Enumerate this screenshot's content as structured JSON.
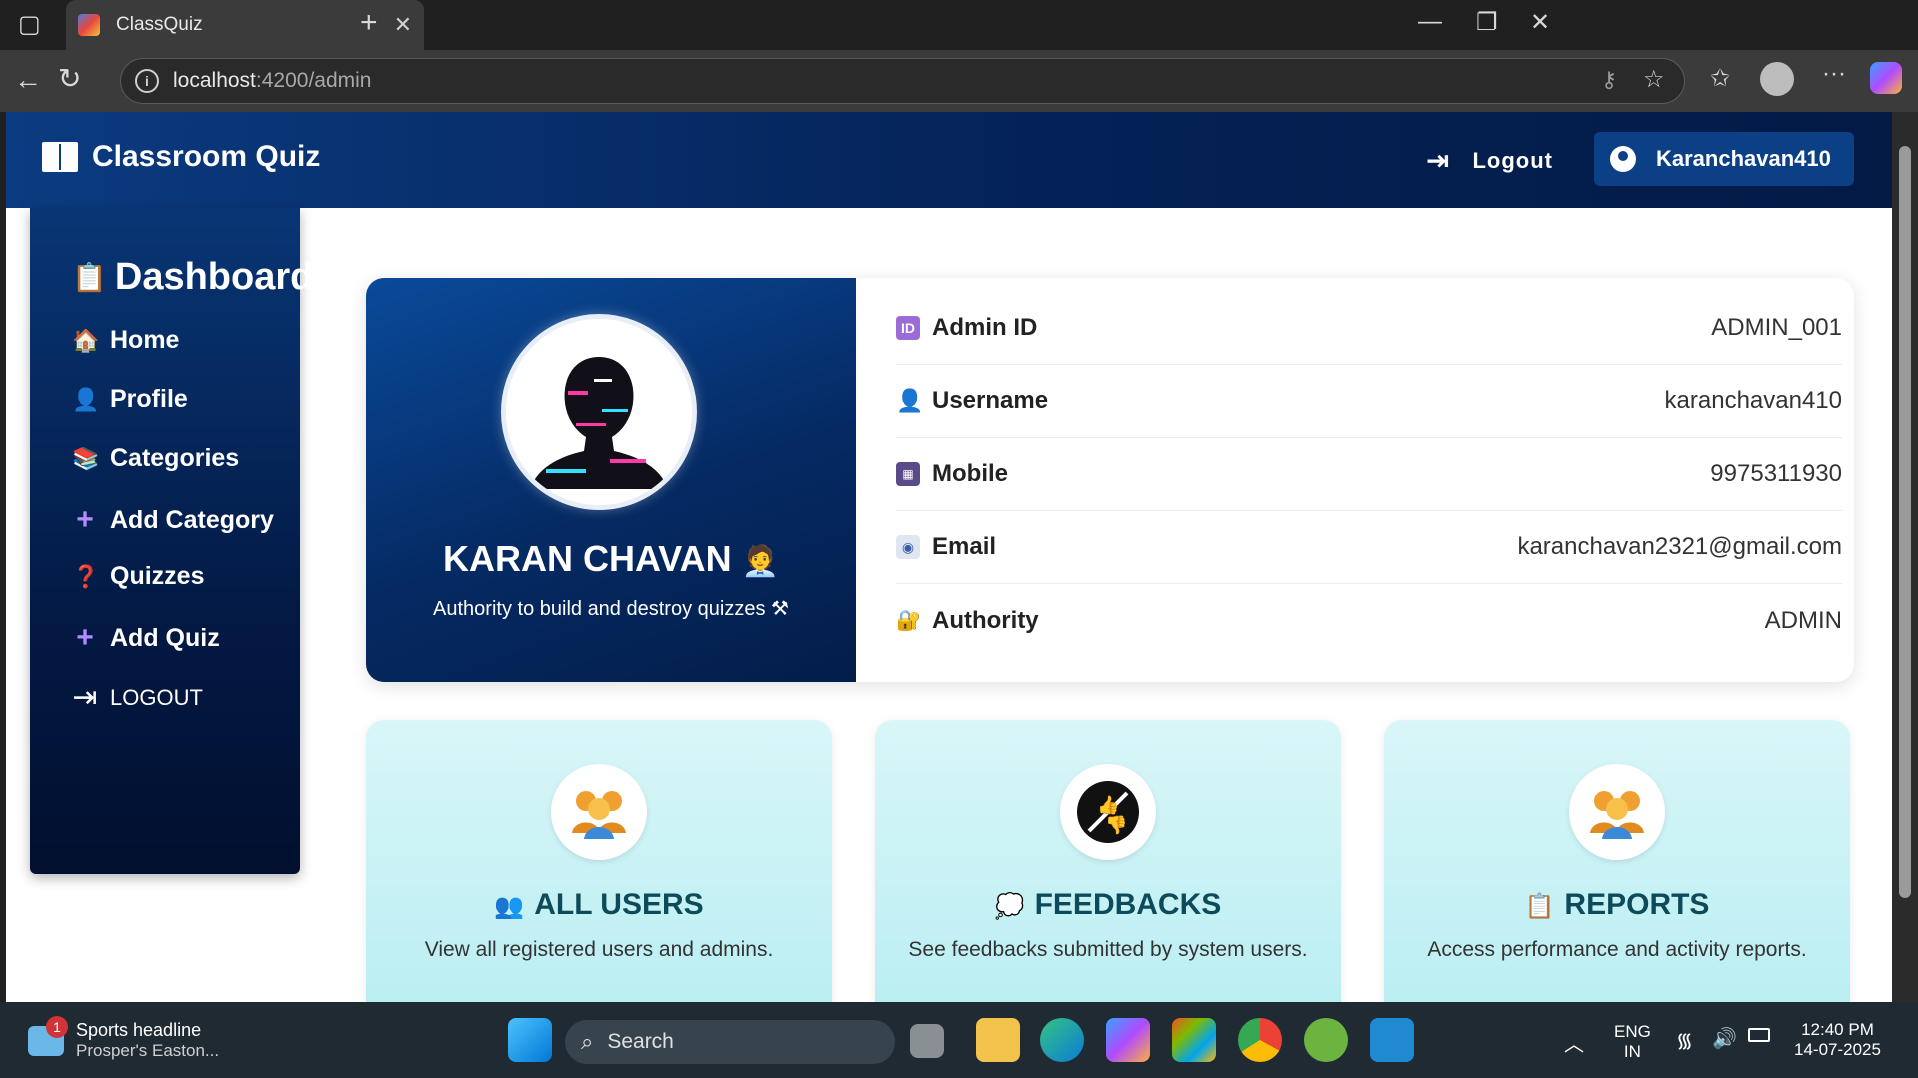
{
  "browser": {
    "tab_title": "ClassQuiz",
    "url_host": "localhost",
    "url_rest": ":4200/admin"
  },
  "navbar": {
    "brand": "Classroom Quiz",
    "logout": "Logout",
    "user": "Karanchavan410"
  },
  "sidebar": {
    "title": "Dashboard",
    "items": [
      {
        "label": "Home",
        "icon": "house-icon"
      },
      {
        "label": "Profile",
        "icon": "person-icon"
      },
      {
        "label": "Categories",
        "icon": "books-icon"
      },
      {
        "label": "Add Category",
        "icon": "plus-icon"
      },
      {
        "label": "Quizzes",
        "icon": "question-icon"
      },
      {
        "label": "Add Quiz",
        "icon": "plus-icon"
      },
      {
        "label": "LOGOUT",
        "icon": "logout-icon"
      }
    ]
  },
  "profile": {
    "name": "KARAN CHAVAN",
    "subtitle": "Authority to build and destroy quizzes",
    "rows": [
      {
        "label": "Admin ID",
        "value": "ADMIN_001",
        "icon": "id-icon"
      },
      {
        "label": "Username",
        "value": "karanchavan410",
        "icon": "user-icon"
      },
      {
        "label": "Mobile",
        "value": "9975311930",
        "icon": "phone-icon"
      },
      {
        "label": "Email",
        "value": "karanchavan2321@gmail.com",
        "icon": "email-icon"
      },
      {
        "label": "Authority",
        "value": "ADMIN",
        "icon": "lock-icon"
      }
    ]
  },
  "cards": [
    {
      "title": "ALL USERS",
      "desc": "View all registered users and admins.",
      "icon": "users-icon"
    },
    {
      "title": "FEEDBACKS",
      "desc": "See feedbacks submitted by system users.",
      "icon": "feedback-icon"
    },
    {
      "title": "REPORTS",
      "desc": "Access performance and activity reports.",
      "icon": "clipboard-icon"
    }
  ],
  "taskbar": {
    "news_badge": "1",
    "news_title": "Sports headline",
    "news_sub": "Prosper's Easton...",
    "search": "Search",
    "lang1": "ENG",
    "lang2": "IN",
    "time": "12:40 PM",
    "date": "14-07-2025"
  },
  "colors": {
    "navbar": "#042257",
    "card_bg": "#c9f2f5",
    "card_title": "#0d4b5a"
  }
}
